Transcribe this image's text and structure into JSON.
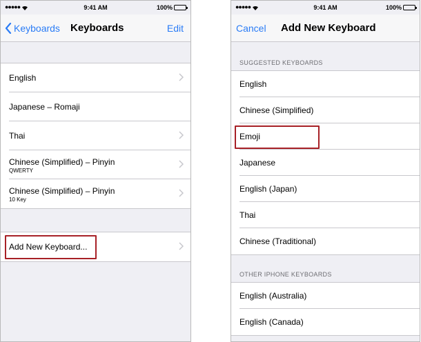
{
  "status_bar": {
    "dots": "●●●●●",
    "time": "9:41 AM",
    "battery": "100%"
  },
  "left_screen": {
    "nav": {
      "back_label": "Keyboards",
      "title": "Keyboards",
      "edit_label": "Edit"
    },
    "keyboards": [
      {
        "label": "English",
        "sub": ""
      },
      {
        "label": "Japanese – Romaji",
        "sub": ""
      },
      {
        "label": "Thai",
        "sub": ""
      },
      {
        "label": "Chinese (Simplified) – Pinyin",
        "sub": "QWERTY"
      },
      {
        "label": "Chinese (Simplified) – Pinyin",
        "sub": "10 Key"
      }
    ],
    "add_label": "Add New Keyboard..."
  },
  "right_screen": {
    "nav": {
      "cancel_label": "Cancel",
      "title": "Add New Keyboard"
    },
    "suggested_header": "SUGGESTED KEYBOARDS",
    "suggested": [
      "English",
      "Chinese (Simplified)",
      "Emoji",
      "Japanese",
      "English (Japan)",
      "Thai",
      "Chinese (Traditional)"
    ],
    "other_header": "OTHER IPHONE KEYBOARDS",
    "other": [
      "English (Australia)",
      "English (Canada)"
    ]
  },
  "colors": {
    "accent": "#2a7cf6",
    "highlight": "#a72026",
    "background": "#efeff4"
  }
}
